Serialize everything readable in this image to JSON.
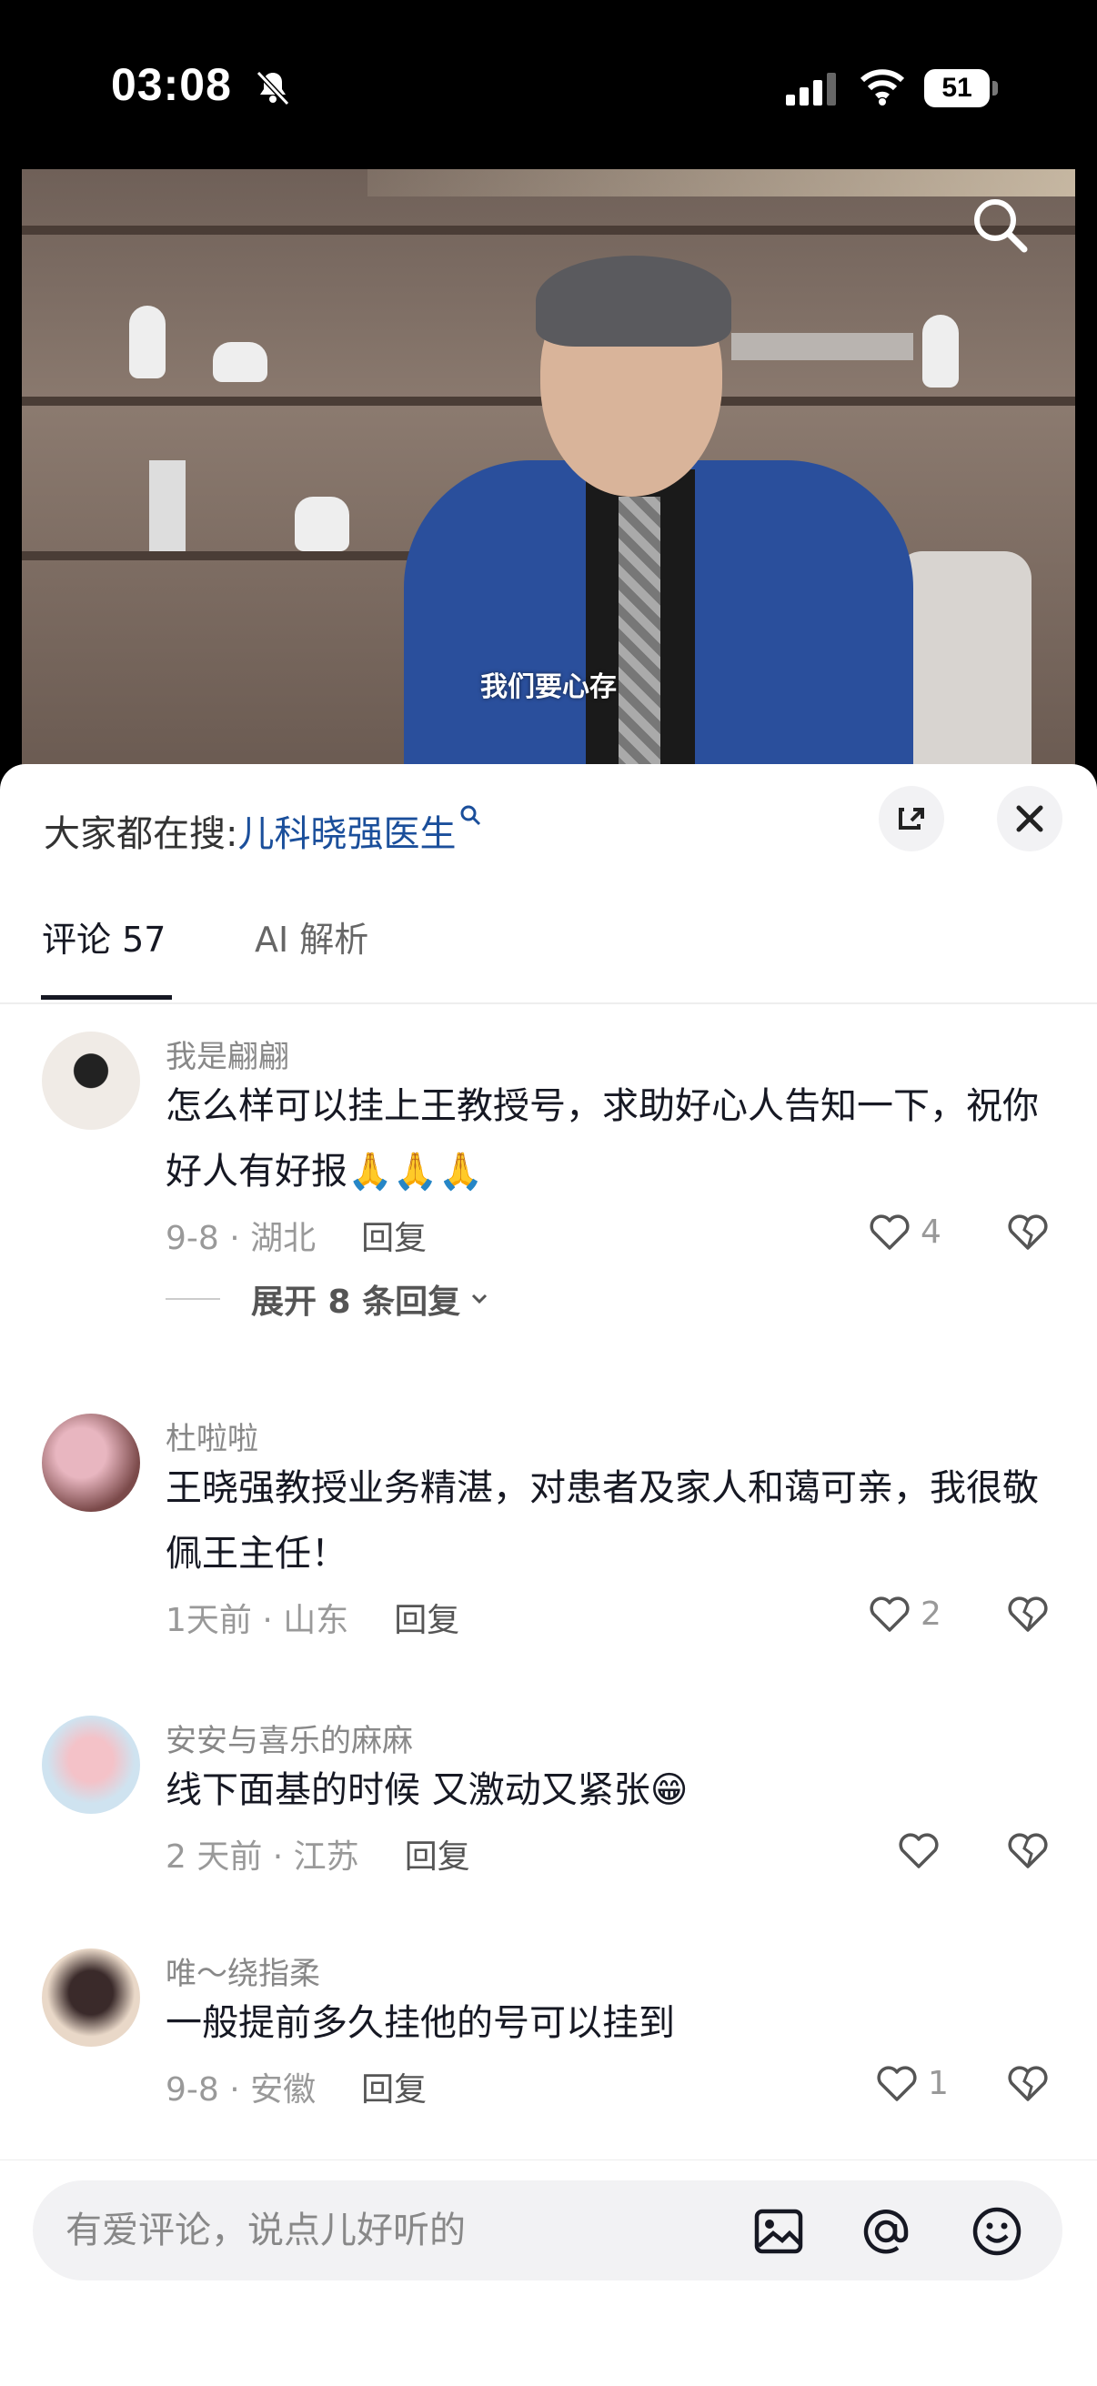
{
  "status_bar": {
    "time": "03:08",
    "battery": "51"
  },
  "video": {
    "subtitle": "我们要心存"
  },
  "sheet": {
    "hot_search_prefix": "大家都在搜:",
    "hot_search_keyword": "儿科晓强医生",
    "tabs": [
      {
        "label": "评论 57",
        "active": true
      },
      {
        "label": "AI 解析",
        "active": false
      }
    ]
  },
  "comments": [
    {
      "name": "我是翩翩",
      "text": "怎么样可以挂上王教授号，求助好心人告知一下，祝你好人有好报🙏🙏🙏",
      "meta": "9-8 · 湖北",
      "reply": "回复",
      "likes": "4",
      "expand": "展开 8 条回复"
    },
    {
      "name": "杜啦啦",
      "text": "王晓强教授业务精湛，对患者及家人和蔼可亲，我很敬佩王主任！",
      "meta": "1天前 · 山东",
      "reply": "回复",
      "likes": "2"
    },
    {
      "name": "安安与喜乐的麻麻",
      "text": "线下面基的时候 又激动又紧张😁",
      "meta": "2 天前 · 江苏",
      "reply": "回复",
      "likes": ""
    },
    {
      "name": "唯～绕指柔",
      "text": "一般提前多久挂他的号可以挂到",
      "meta": "9-8 · 安徽",
      "reply": "回复",
      "likes": "1"
    }
  ],
  "input": {
    "placeholder": "有爱评论，说点儿好听的"
  },
  "icons": {
    "bell": "bell-slash-icon",
    "signal": "cellular-signal-icon",
    "wifi": "wifi-icon",
    "search": "search-icon",
    "expand": "expand-icon",
    "close": "close-icon",
    "like": "heart-icon",
    "dislike": "broken-heart-icon",
    "image": "image-icon",
    "at": "at-icon",
    "emoji": "emoji-icon"
  }
}
